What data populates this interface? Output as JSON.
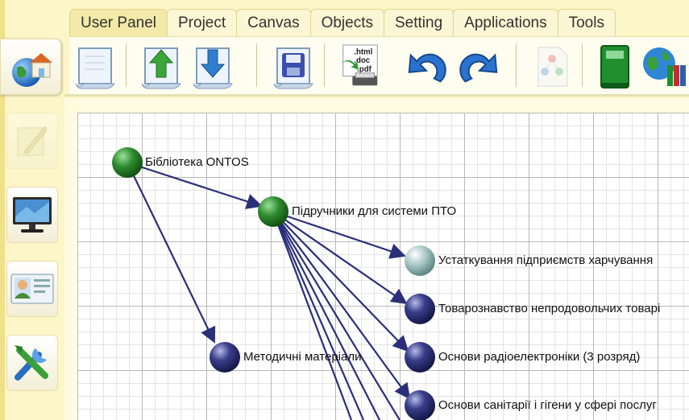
{
  "tabs": [
    "User Panel",
    "Project",
    "Canvas",
    "Objects",
    "Setting",
    "Applications",
    "Tools"
  ],
  "active_tab": "User Panel",
  "toolbar_icons": [
    "new-document-icon",
    "upload-icon",
    "download-icon",
    "save-disk-icon",
    "export-formats-icon",
    "undo-icon",
    "redo-icon",
    "graph-document-icon",
    "green-book-icon",
    "globe-library-icon"
  ],
  "export_formats": [
    ".html",
    ".doc",
    ".pdf"
  ],
  "sidebar_icons": [
    "home-globe-icon",
    "quill-pen-icon",
    "monitor-icon",
    "user-card-icon",
    "tools-icon"
  ],
  "graph": {
    "nodes": [
      {
        "label": "Бібліотека ONTOS",
        "color": "green"
      },
      {
        "label": "Підручники для системи ПТО",
        "color": "green"
      },
      {
        "label": "Устаткування підприємств харчування",
        "color": "gray"
      },
      {
        "label": "Товарознавство непродовольчих товарі",
        "color": "navy"
      },
      {
        "label": "Основи радіоелектроніки (3 розряд)",
        "color": "navy"
      },
      {
        "label": "Основи санітарії і гігени у сфері послуг",
        "color": "navy"
      },
      {
        "label": "Методичні матеріали",
        "color": "navy"
      }
    ]
  },
  "colors": {
    "edge": "#2b2f7a",
    "green_node": "#2e8b2e",
    "navy_node": "#2a2d6e",
    "gray_node": "#a9c8c6",
    "panel": "#fcf6c8"
  }
}
